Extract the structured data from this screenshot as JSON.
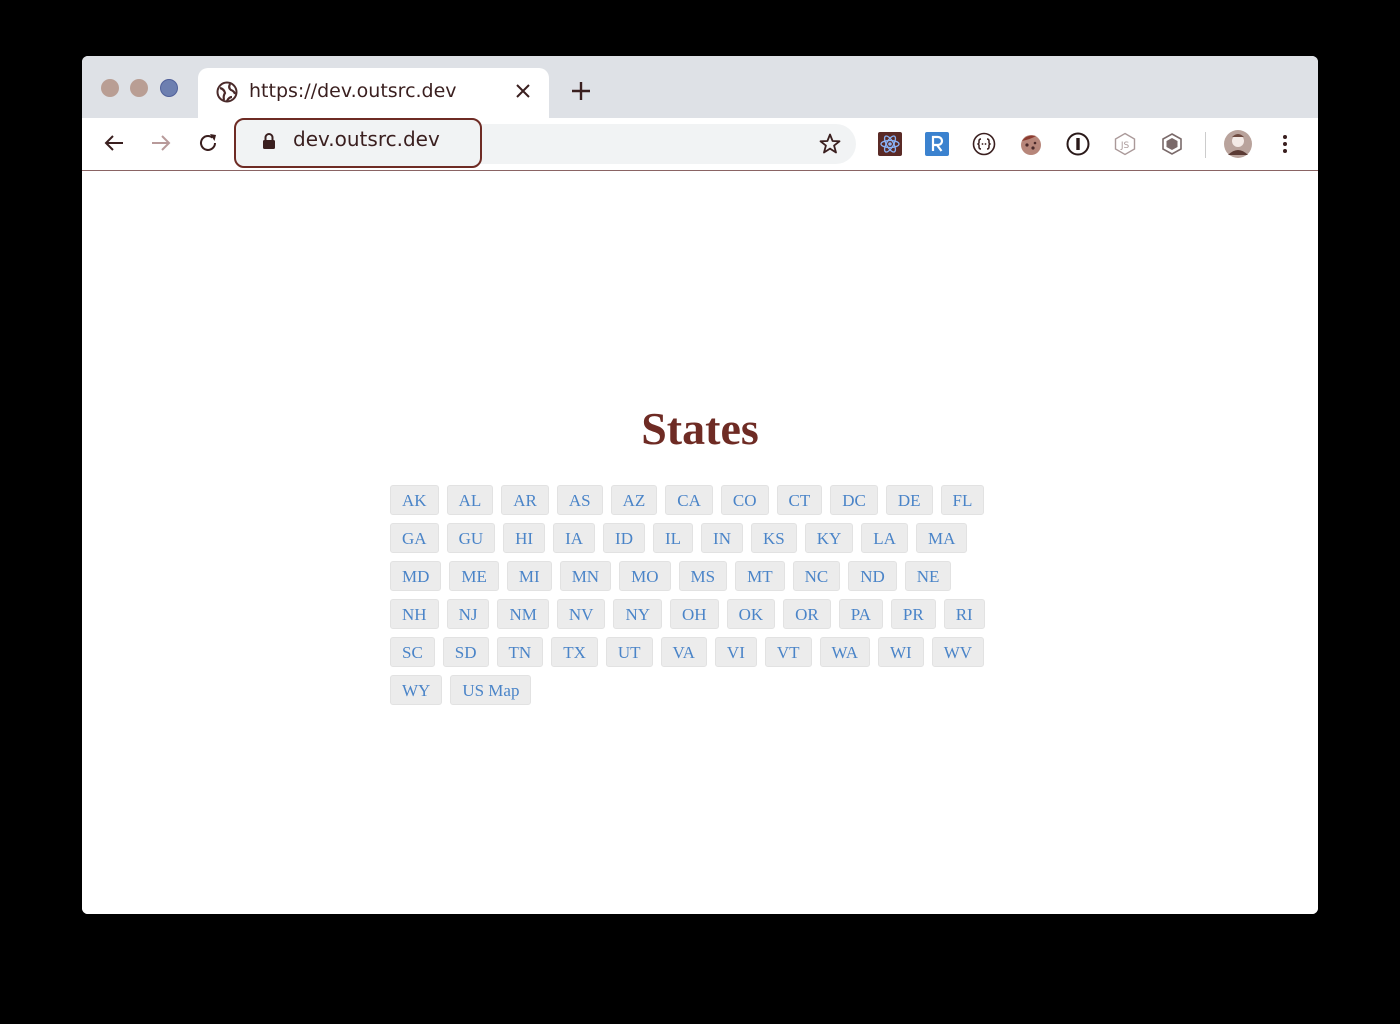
{
  "browser": {
    "tab": {
      "title": "https://dev.outsrc.dev",
      "favicon": "globe-icon"
    },
    "address": {
      "url": "dev.outsrc.dev"
    },
    "extensions": [
      "react-devtools-icon",
      "r-extension-icon",
      "json-formatter-icon",
      "cookie-extension-icon",
      "password-manager-icon",
      "nodejs-icon",
      "cube-extension-icon"
    ]
  },
  "page": {
    "title": "States",
    "links": [
      "AK",
      "AL",
      "AR",
      "AS",
      "AZ",
      "CA",
      "CO",
      "CT",
      "DC",
      "DE",
      "FL",
      "GA",
      "GU",
      "HI",
      "IA",
      "ID",
      "IL",
      "IN",
      "KS",
      "KY",
      "LA",
      "MA",
      "MD",
      "ME",
      "MI",
      "MN",
      "MO",
      "MS",
      "MT",
      "NC",
      "ND",
      "NE",
      "NH",
      "NJ",
      "NM",
      "NV",
      "NY",
      "OH",
      "OK",
      "OR",
      "PA",
      "PR",
      "RI",
      "SC",
      "SD",
      "TN",
      "TX",
      "UT",
      "VA",
      "VI",
      "VT",
      "WA",
      "WI",
      "WV",
      "WY",
      "US Map"
    ]
  },
  "colors": {
    "title": "#6e2b24",
    "link": "#4a84c8",
    "link_bg": "#ececec",
    "tabstrip": "#dee1e6",
    "focus_ring": "#6e2b24"
  }
}
